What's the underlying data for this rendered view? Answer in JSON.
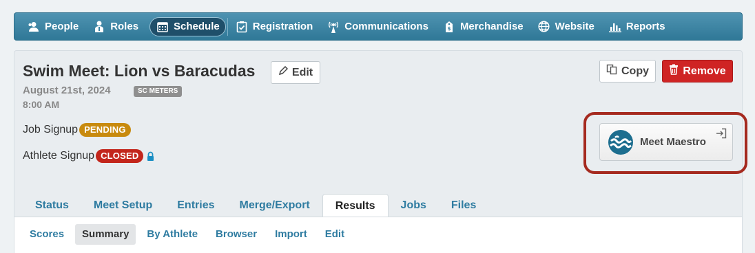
{
  "nav": {
    "items": [
      {
        "label": "People",
        "icon": "people-icon"
      },
      {
        "label": "Roles",
        "icon": "roles-icon"
      },
      {
        "label": "Schedule",
        "icon": "calendar-icon"
      },
      {
        "label": "Registration",
        "icon": "clipboard-icon"
      },
      {
        "label": "Communications",
        "icon": "broadcast-icon"
      },
      {
        "label": "Merchandise",
        "icon": "tag-icon"
      },
      {
        "label": "Website",
        "icon": "globe-icon"
      },
      {
        "label": "Reports",
        "icon": "bar-chart-icon"
      }
    ],
    "active": "Schedule"
  },
  "event": {
    "title": "Swim Meet: Lion vs Baracudas",
    "edit_label": "Edit",
    "copy_label": "Copy",
    "remove_label": "Remove",
    "date": "August 21st, 2024",
    "course_badge": "SC METERS",
    "time": "8:00 AM"
  },
  "signups": {
    "job_label": "Job Signup",
    "job_status": "PENDING",
    "athlete_label": "Athlete Signup",
    "athlete_status": "CLOSED"
  },
  "integration": {
    "label": "Meet Maestro"
  },
  "tabs": {
    "items": [
      "Status",
      "Meet Setup",
      "Entries",
      "Merge/Export",
      "Results",
      "Jobs",
      "Files"
    ],
    "active": "Results"
  },
  "subtabs": {
    "items": [
      "Scores",
      "Summary",
      "By Athlete",
      "Browser",
      "Import",
      "Edit"
    ],
    "active": "Summary"
  },
  "colors": {
    "nav_bg": "#3a84a4",
    "link": "#2f7ca1",
    "remove": "#cf2424",
    "pending": "#c88a0e",
    "closed": "#c3261c",
    "highlight_ring": "#a52a1f"
  }
}
